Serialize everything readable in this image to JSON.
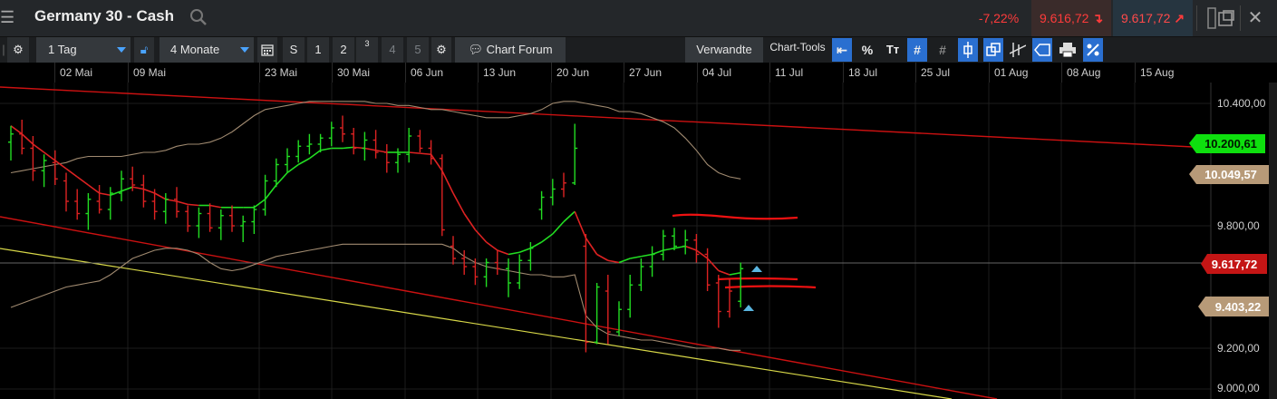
{
  "title_bar": {
    "title": "Germany 30 - Cash",
    "change_pct": "-7,22%",
    "bid": "9.616,72",
    "ask": "9.617,72"
  },
  "toolbar": {
    "interval": "1 Tag",
    "range": "4 Monate",
    "buttons": [
      "S",
      "1",
      "2",
      "3",
      "4",
      "5"
    ],
    "chart_forum": "Chart Forum",
    "related": "Verwandte",
    "chart_tools": "Chart-Tools",
    "tool_percent": "%",
    "tool_text": "Tт"
  },
  "date_axis": [
    "02 Mai",
    "09 Mai",
    "23 Mai",
    "30 Mai",
    "06 Jun",
    "13 Jun",
    "20 Jun",
    "27 Jun",
    "04 Jul",
    "11 Jul",
    "18 Jul",
    "25 Jul",
    "01 Aug",
    "08 Aug",
    "15 Aug"
  ],
  "price_axis": [
    "10.400,00",
    "9.800,00",
    "9.200,00",
    "9.000,00"
  ],
  "price_tags": {
    "green": "10.200,61",
    "tan_upper": "10.049,57",
    "red": "9.617,72",
    "tan_lower": "9.403,22"
  },
  "colors": {
    "up": "#22dd22",
    "down": "#dd2222",
    "band": "#a08a70",
    "trend": "#cc1111",
    "yellow": "#d8d848",
    "accent": "#2a6fd0"
  },
  "chart_data": {
    "type": "ohlc",
    "y_axis_labels": [
      10400,
      9800,
      9200,
      9000
    ],
    "bars": [
      {
        "o": 10210,
        "h": 10290,
        "l": 10120,
        "c": 10250,
        "up": true
      },
      {
        "o": 10250,
        "h": 10320,
        "l": 10150,
        "c": 10180,
        "up": false
      },
      {
        "o": 10180,
        "h": 10240,
        "l": 10020,
        "c": 10070,
        "up": false
      },
      {
        "o": 10070,
        "h": 10150,
        "l": 9990,
        "c": 10120,
        "up": true
      },
      {
        "o": 10110,
        "h": 10170,
        "l": 10000,
        "c": 10030,
        "up": false
      },
      {
        "o": 10020,
        "h": 10060,
        "l": 9870,
        "c": 9920,
        "up": false
      },
      {
        "o": 9920,
        "h": 9980,
        "l": 9830,
        "c": 9860,
        "up": false
      },
      {
        "o": 9860,
        "h": 9960,
        "l": 9780,
        "c": 9930,
        "up": true
      },
      {
        "o": 9920,
        "h": 10000,
        "l": 9860,
        "c": 9880,
        "up": false
      },
      {
        "o": 9880,
        "h": 9990,
        "l": 9830,
        "c": 9960,
        "up": true
      },
      {
        "o": 9960,
        "h": 10070,
        "l": 9920,
        "c": 10030,
        "up": true
      },
      {
        "o": 10030,
        "h": 10090,
        "l": 9970,
        "c": 10000,
        "up": false
      },
      {
        "o": 10000,
        "h": 10050,
        "l": 9890,
        "c": 9920,
        "up": false
      },
      {
        "o": 9920,
        "h": 9980,
        "l": 9830,
        "c": 9870,
        "up": false
      },
      {
        "o": 9870,
        "h": 9960,
        "l": 9810,
        "c": 9930,
        "up": true
      },
      {
        "o": 9930,
        "h": 9990,
        "l": 9840,
        "c": 9870,
        "up": false
      },
      {
        "o": 9870,
        "h": 9900,
        "l": 9770,
        "c": 9800,
        "up": false
      },
      {
        "o": 9800,
        "h": 9890,
        "l": 9740,
        "c": 9860,
        "up": true
      },
      {
        "o": 9860,
        "h": 9910,
        "l": 9770,
        "c": 9790,
        "up": false
      },
      {
        "o": 9790,
        "h": 9880,
        "l": 9730,
        "c": 9850,
        "up": true
      },
      {
        "o": 9850,
        "h": 9900,
        "l": 9770,
        "c": 9800,
        "up": false
      },
      {
        "o": 9800,
        "h": 9850,
        "l": 9720,
        "c": 9820,
        "up": true
      },
      {
        "o": 9820,
        "h": 9900,
        "l": 9760,
        "c": 9880,
        "up": true
      },
      {
        "o": 9880,
        "h": 10050,
        "l": 9850,
        "c": 10020,
        "up": true
      },
      {
        "o": 10020,
        "h": 10130,
        "l": 9990,
        "c": 10100,
        "up": true
      },
      {
        "o": 10100,
        "h": 10180,
        "l": 10060,
        "c": 10140,
        "up": true
      },
      {
        "o": 10140,
        "h": 10220,
        "l": 10110,
        "c": 10190,
        "up": true
      },
      {
        "o": 10190,
        "h": 10250,
        "l": 10150,
        "c": 10200,
        "up": true
      },
      {
        "o": 10200,
        "h": 10250,
        "l": 10160,
        "c": 10230,
        "up": true
      },
      {
        "o": 10230,
        "h": 10310,
        "l": 10190,
        "c": 10280,
        "up": true
      },
      {
        "o": 10280,
        "h": 10340,
        "l": 10210,
        "c": 10250,
        "up": false
      },
      {
        "o": 10250,
        "h": 10280,
        "l": 10150,
        "c": 10180,
        "up": false
      },
      {
        "o": 10180,
        "h": 10260,
        "l": 10120,
        "c": 10220,
        "up": true
      },
      {
        "o": 10220,
        "h": 10270,
        "l": 10130,
        "c": 10160,
        "up": false
      },
      {
        "o": 10160,
        "h": 10200,
        "l": 10060,
        "c": 10110,
        "up": false
      },
      {
        "o": 10110,
        "h": 10180,
        "l": 10060,
        "c": 10150,
        "up": true
      },
      {
        "o": 10150,
        "h": 10280,
        "l": 10110,
        "c": 10240,
        "up": true
      },
      {
        "o": 10240,
        "h": 10270,
        "l": 10160,
        "c": 10180,
        "up": false
      },
      {
        "o": 10180,
        "h": 10220,
        "l": 10100,
        "c": 10130,
        "up": false
      },
      {
        "o": 10130,
        "h": 10150,
        "l": 9750,
        "c": 9780,
        "up": false
      },
      {
        "o": 9700,
        "h": 9750,
        "l": 9610,
        "c": 9640,
        "up": false
      },
      {
        "o": 9640,
        "h": 9680,
        "l": 9560,
        "c": 9600,
        "up": false
      },
      {
        "o": 9600,
        "h": 9640,
        "l": 9510,
        "c": 9550,
        "up": false
      },
      {
        "o": 9550,
        "h": 9640,
        "l": 9500,
        "c": 9620,
        "up": true
      },
      {
        "o": 9620,
        "h": 9680,
        "l": 9560,
        "c": 9590,
        "up": false
      },
      {
        "o": 9590,
        "h": 9640,
        "l": 9450,
        "c": 9520,
        "up": true
      },
      {
        "o": 9520,
        "h": 9660,
        "l": 9490,
        "c": 9630,
        "up": true
      },
      {
        "o": 9630,
        "h": 9720,
        "l": 9580,
        "c": 9690,
        "up": true
      },
      {
        "o": 9880,
        "h": 9970,
        "l": 9830,
        "c": 9940,
        "up": true
      },
      {
        "o": 9940,
        "h": 10030,
        "l": 9900,
        "c": 9980,
        "up": true
      },
      {
        "o": 9980,
        "h": 10060,
        "l": 9940,
        "c": 10010,
        "up": false
      },
      {
        "o": 10010,
        "h": 10300,
        "l": 10000,
        "c": 10180,
        "up": true
      },
      {
        "o": 9700,
        "h": 9760,
        "l": 9180,
        "c": 9230,
        "up": false
      },
      {
        "o": 9230,
        "h": 9520,
        "l": 9220,
        "c": 9500,
        "up": true
      },
      {
        "o": 9480,
        "h": 9560,
        "l": 9220,
        "c": 9280,
        "up": false
      },
      {
        "o": 9280,
        "h": 9430,
        "l": 9260,
        "c": 9390,
        "up": true
      },
      {
        "o": 9390,
        "h": 9560,
        "l": 9350,
        "c": 9510,
        "up": true
      },
      {
        "o": 9510,
        "h": 9640,
        "l": 9480,
        "c": 9600,
        "up": true
      },
      {
        "o": 9600,
        "h": 9700,
        "l": 9550,
        "c": 9660,
        "up": true
      },
      {
        "o": 9660,
        "h": 9780,
        "l": 9630,
        "c": 9750,
        "up": true
      },
      {
        "o": 9750,
        "h": 9790,
        "l": 9680,
        "c": 9700,
        "up": true
      },
      {
        "o": 9700,
        "h": 9780,
        "l": 9660,
        "c": 9730,
        "up": true
      },
      {
        "o": 9730,
        "h": 9760,
        "l": 9620,
        "c": 9660,
        "up": false
      },
      {
        "o": 9660,
        "h": 9690,
        "l": 9480,
        "c": 9510,
        "up": false
      },
      {
        "o": 9520,
        "h": 9560,
        "l": 9300,
        "c": 9380,
        "up": false
      },
      {
        "o": 9380,
        "h": 9540,
        "l": 9350,
        "c": 9480,
        "up": false
      },
      {
        "o": 9430,
        "h": 9620,
        "l": 9400,
        "c": 9590,
        "up": true
      }
    ],
    "series": [
      {
        "name": "ma_green_red",
        "values": [
          10290,
          10250,
          10200,
          10160,
          10120,
          10080,
          10040,
          10000,
          9960,
          9950,
          9970,
          9990,
          9980,
          9960,
          9930,
          9920,
          9905,
          9900,
          9900,
          9890,
          9890,
          9890,
          9890,
          9930,
          10000,
          10060,
          10100,
          10130,
          10170,
          10180,
          10180,
          10185,
          10180,
          10170,
          10160,
          10160,
          10160,
          10155,
          10150,
          10070,
          9960,
          9860,
          9780,
          9720,
          9680,
          9660,
          9670,
          9690,
          9720,
          9760,
          9820,
          9870,
          9740,
          9660,
          9630,
          9620,
          9640,
          9650,
          9660,
          9680,
          9690,
          9700,
          9680,
          9640,
          9580,
          9560,
          9570
        ]
      },
      {
        "name": "band_upper",
        "values": [
          10060,
          10070,
          10080,
          10090,
          10100,
          10110,
          10130,
          10140,
          10140,
          10140,
          10140,
          10150,
          10160,
          10160,
          10170,
          10190,
          10200,
          10200,
          10210,
          10230,
          10260,
          10300,
          10340,
          10370,
          10380,
          10390,
          10400,
          10410,
          10410,
          10410,
          10410,
          10410,
          10410,
          10400,
          10400,
          10390,
          10390,
          10380,
          10370,
          10370,
          10360,
          10350,
          10340,
          10330,
          10330,
          10330,
          10340,
          10350,
          10370,
          10400,
          10410,
          10410,
          10400,
          10390,
          10380,
          10360,
          10360,
          10350,
          10330,
          10310,
          10280,
          10230,
          10170,
          10100,
          10060,
          10040,
          10030
        ]
      },
      {
        "name": "band_lower",
        "values": [
          9400,
          9420,
          9440,
          9460,
          9480,
          9500,
          9510,
          9520,
          9530,
          9560,
          9600,
          9640,
          9660,
          9680,
          9690,
          9690,
          9680,
          9660,
          9620,
          9590,
          9580,
          9590,
          9610,
          9630,
          9650,
          9660,
          9670,
          9680,
          9690,
          9700,
          9710,
          9710,
          9710,
          9710,
          9710,
          9710,
          9710,
          9710,
          9710,
          9710,
          9690,
          9650,
          9620,
          9600,
          9590,
          9580,
          9570,
          9560,
          9560,
          9550,
          9550,
          9560,
          9360,
          9300,
          9270,
          9260,
          9250,
          9240,
          9240,
          9230,
          9220,
          9210,
          9200,
          9200,
          9200,
          9190,
          9190
        ]
      }
    ]
  }
}
